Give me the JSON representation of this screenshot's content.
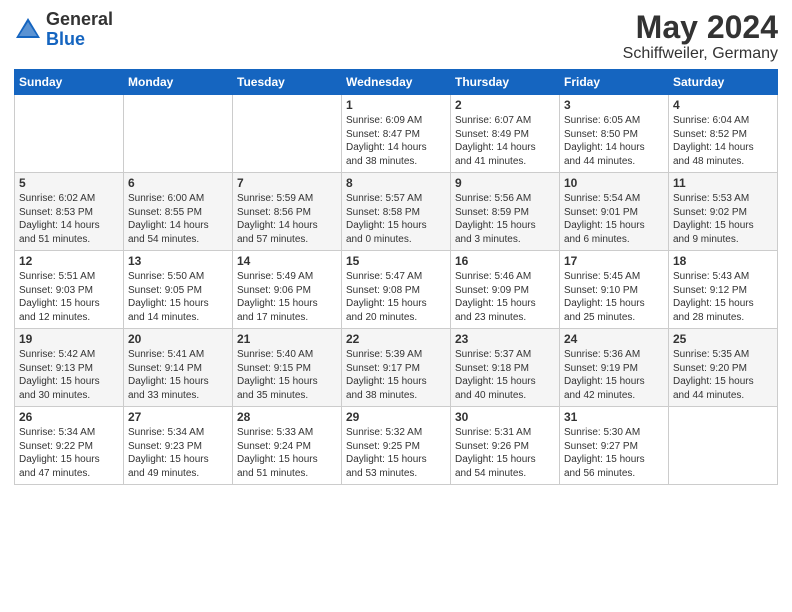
{
  "header": {
    "logo_general": "General",
    "logo_blue": "Blue",
    "month": "May 2024",
    "location": "Schiffweiler, Germany"
  },
  "weekdays": [
    "Sunday",
    "Monday",
    "Tuesday",
    "Wednesday",
    "Thursday",
    "Friday",
    "Saturday"
  ],
  "weeks": [
    [
      {
        "num": "",
        "info": ""
      },
      {
        "num": "",
        "info": ""
      },
      {
        "num": "",
        "info": ""
      },
      {
        "num": "1",
        "info": "Sunrise: 6:09 AM\nSunset: 8:47 PM\nDaylight: 14 hours\nand 38 minutes."
      },
      {
        "num": "2",
        "info": "Sunrise: 6:07 AM\nSunset: 8:49 PM\nDaylight: 14 hours\nand 41 minutes."
      },
      {
        "num": "3",
        "info": "Sunrise: 6:05 AM\nSunset: 8:50 PM\nDaylight: 14 hours\nand 44 minutes."
      },
      {
        "num": "4",
        "info": "Sunrise: 6:04 AM\nSunset: 8:52 PM\nDaylight: 14 hours\nand 48 minutes."
      }
    ],
    [
      {
        "num": "5",
        "info": "Sunrise: 6:02 AM\nSunset: 8:53 PM\nDaylight: 14 hours\nand 51 minutes."
      },
      {
        "num": "6",
        "info": "Sunrise: 6:00 AM\nSunset: 8:55 PM\nDaylight: 14 hours\nand 54 minutes."
      },
      {
        "num": "7",
        "info": "Sunrise: 5:59 AM\nSunset: 8:56 PM\nDaylight: 14 hours\nand 57 minutes."
      },
      {
        "num": "8",
        "info": "Sunrise: 5:57 AM\nSunset: 8:58 PM\nDaylight: 15 hours\nand 0 minutes."
      },
      {
        "num": "9",
        "info": "Sunrise: 5:56 AM\nSunset: 8:59 PM\nDaylight: 15 hours\nand 3 minutes."
      },
      {
        "num": "10",
        "info": "Sunrise: 5:54 AM\nSunset: 9:01 PM\nDaylight: 15 hours\nand 6 minutes."
      },
      {
        "num": "11",
        "info": "Sunrise: 5:53 AM\nSunset: 9:02 PM\nDaylight: 15 hours\nand 9 minutes."
      }
    ],
    [
      {
        "num": "12",
        "info": "Sunrise: 5:51 AM\nSunset: 9:03 PM\nDaylight: 15 hours\nand 12 minutes."
      },
      {
        "num": "13",
        "info": "Sunrise: 5:50 AM\nSunset: 9:05 PM\nDaylight: 15 hours\nand 14 minutes."
      },
      {
        "num": "14",
        "info": "Sunrise: 5:49 AM\nSunset: 9:06 PM\nDaylight: 15 hours\nand 17 minutes."
      },
      {
        "num": "15",
        "info": "Sunrise: 5:47 AM\nSunset: 9:08 PM\nDaylight: 15 hours\nand 20 minutes."
      },
      {
        "num": "16",
        "info": "Sunrise: 5:46 AM\nSunset: 9:09 PM\nDaylight: 15 hours\nand 23 minutes."
      },
      {
        "num": "17",
        "info": "Sunrise: 5:45 AM\nSunset: 9:10 PM\nDaylight: 15 hours\nand 25 minutes."
      },
      {
        "num": "18",
        "info": "Sunrise: 5:43 AM\nSunset: 9:12 PM\nDaylight: 15 hours\nand 28 minutes."
      }
    ],
    [
      {
        "num": "19",
        "info": "Sunrise: 5:42 AM\nSunset: 9:13 PM\nDaylight: 15 hours\nand 30 minutes."
      },
      {
        "num": "20",
        "info": "Sunrise: 5:41 AM\nSunset: 9:14 PM\nDaylight: 15 hours\nand 33 minutes."
      },
      {
        "num": "21",
        "info": "Sunrise: 5:40 AM\nSunset: 9:15 PM\nDaylight: 15 hours\nand 35 minutes."
      },
      {
        "num": "22",
        "info": "Sunrise: 5:39 AM\nSunset: 9:17 PM\nDaylight: 15 hours\nand 38 minutes."
      },
      {
        "num": "23",
        "info": "Sunrise: 5:37 AM\nSunset: 9:18 PM\nDaylight: 15 hours\nand 40 minutes."
      },
      {
        "num": "24",
        "info": "Sunrise: 5:36 AM\nSunset: 9:19 PM\nDaylight: 15 hours\nand 42 minutes."
      },
      {
        "num": "25",
        "info": "Sunrise: 5:35 AM\nSunset: 9:20 PM\nDaylight: 15 hours\nand 44 minutes."
      }
    ],
    [
      {
        "num": "26",
        "info": "Sunrise: 5:34 AM\nSunset: 9:22 PM\nDaylight: 15 hours\nand 47 minutes."
      },
      {
        "num": "27",
        "info": "Sunrise: 5:34 AM\nSunset: 9:23 PM\nDaylight: 15 hours\nand 49 minutes."
      },
      {
        "num": "28",
        "info": "Sunrise: 5:33 AM\nSunset: 9:24 PM\nDaylight: 15 hours\nand 51 minutes."
      },
      {
        "num": "29",
        "info": "Sunrise: 5:32 AM\nSunset: 9:25 PM\nDaylight: 15 hours\nand 53 minutes."
      },
      {
        "num": "30",
        "info": "Sunrise: 5:31 AM\nSunset: 9:26 PM\nDaylight: 15 hours\nand 54 minutes."
      },
      {
        "num": "31",
        "info": "Sunrise: 5:30 AM\nSunset: 9:27 PM\nDaylight: 15 hours\nand 56 minutes."
      },
      {
        "num": "",
        "info": ""
      }
    ]
  ]
}
